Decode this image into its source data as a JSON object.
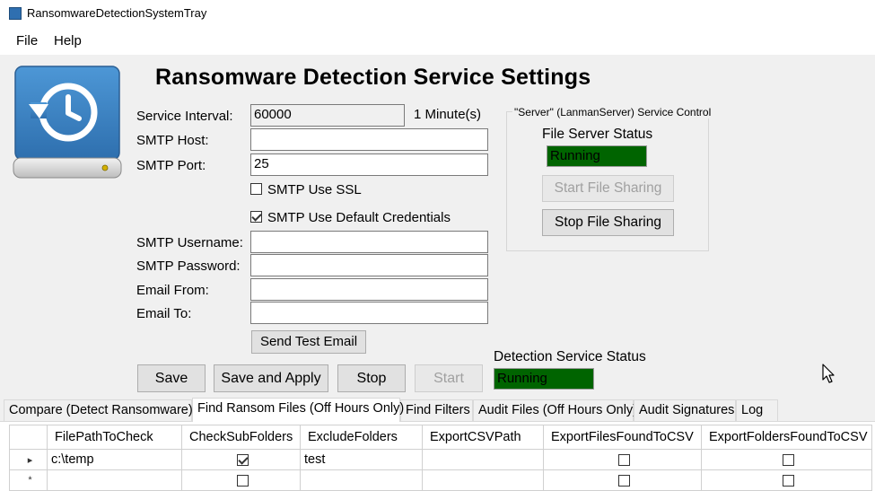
{
  "window": {
    "title": "RansomwareDetectionSystemTray"
  },
  "menu": {
    "items": [
      "File",
      "Help"
    ]
  },
  "heading": "Ransomware Detection Service Settings",
  "form": {
    "service_interval": {
      "label": "Service Interval:",
      "value": "60000",
      "suffix": "1 Minute(s)"
    },
    "smtp_host": {
      "label": "SMTP Host:",
      "value": ""
    },
    "smtp_port": {
      "label": "SMTP Port:",
      "value": "25"
    },
    "smtp_use_ssl": {
      "label": "SMTP Use SSL",
      "checked": false
    },
    "smtp_use_default_credentials": {
      "label": "SMTP Use Default Credentials",
      "checked": true
    },
    "smtp_username": {
      "label": "SMTP Username:",
      "value": ""
    },
    "smtp_password": {
      "label": "SMTP Password:",
      "value": ""
    },
    "email_from": {
      "label": "Email From:",
      "value": ""
    },
    "email_to": {
      "label": "Email To:",
      "value": ""
    },
    "send_test_email": "Send Test Email"
  },
  "service_control": {
    "legend": "\"Server\" (LanmanServer) Service Control",
    "status_label": "File Server Status",
    "status_value": "Running",
    "start_button": "Start File Sharing",
    "stop_button": "Stop File Sharing"
  },
  "actions": {
    "save": "Save",
    "save_and_apply": "Save and Apply",
    "stop": "Stop",
    "start": "Start",
    "detection_status_label": "Detection Service Status",
    "detection_status_value": "Running"
  },
  "tabs": [
    {
      "label": "Compare (Detect Ransomware)"
    },
    {
      "label": "Find Ransom Files (Off Hours Only)",
      "active": true
    },
    {
      "label": "Find Filters"
    },
    {
      "label": "Audit Files (Off Hours Only)"
    },
    {
      "label": "Audit Signatures"
    },
    {
      "label": "Log"
    }
  ],
  "grid": {
    "columns": [
      "FilePathToCheck",
      "CheckSubFolders",
      "ExcludeFolders",
      "ExportCSVPath",
      "ExportFilesFoundToCSV",
      "ExportFoldersFoundToCSV"
    ],
    "rows": [
      {
        "indicator": "▸",
        "FilePathToCheck": "c:\\temp",
        "CheckSubFolders": true,
        "ExcludeFolders": "test",
        "ExportCSVPath": "",
        "ExportFilesFoundToCSV": false,
        "ExportFoldersFoundToCSV": false
      },
      {
        "indicator": "*",
        "FilePathToCheck": "",
        "CheckSubFolders": false,
        "ExcludeFolders": "",
        "ExportCSVPath": "",
        "ExportFilesFoundToCSV": false,
        "ExportFoldersFoundToCSV": false
      }
    ]
  },
  "colors": {
    "status_running_bg": "#006400",
    "window_bg": "#f0f0f0",
    "logo_blue": "#3a7fc1"
  }
}
